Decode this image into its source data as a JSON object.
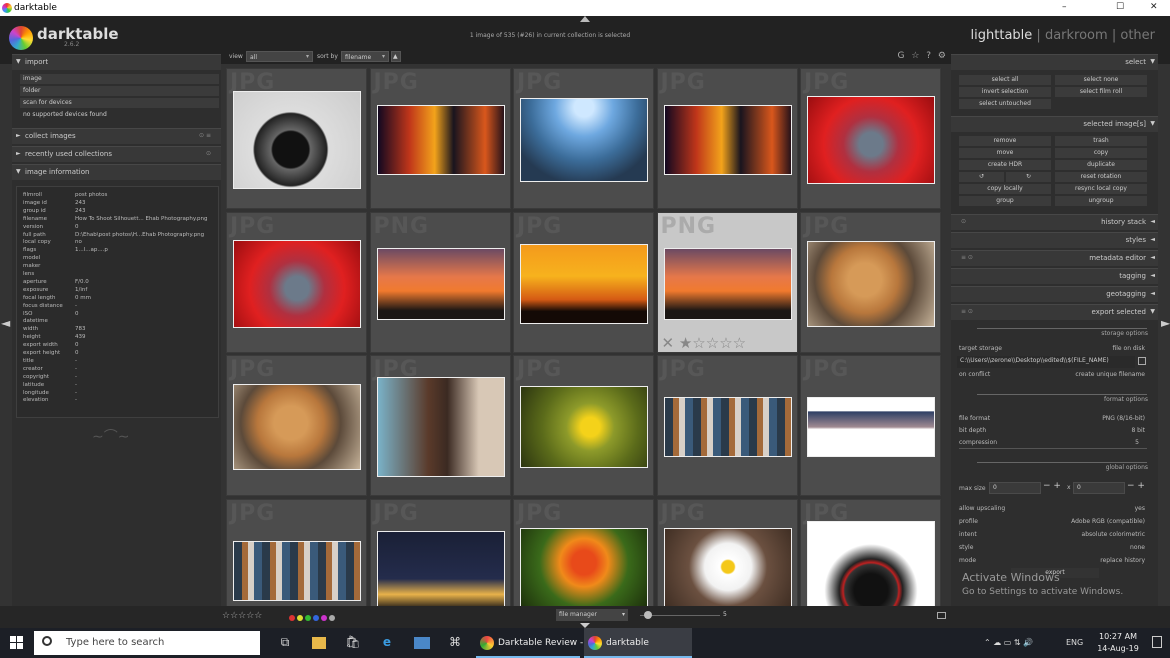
{
  "window": {
    "title": "darktable",
    "controls": [
      "–",
      "☐",
      "✕"
    ]
  },
  "header": {
    "app_name": "darktable",
    "version": "2.6.2",
    "hint": "1 image of 535 (#26) in current collection is selected",
    "views": {
      "lighttable": "lighttable",
      "sep1": "|",
      "darkroom": "darkroom",
      "sep2": "|",
      "other": "other"
    }
  },
  "toolbar": {
    "view_label": "view",
    "view_value": "all",
    "sort_label": "sort by",
    "sort_value": "filename",
    "sort_dir": "▲",
    "icons": [
      "G",
      "☆",
      "?",
      "⚙"
    ]
  },
  "left_panel": {
    "import": {
      "title": "import",
      "items": [
        "image",
        "folder",
        "scan for devices",
        "no supported devices found"
      ]
    },
    "collect_images": "collect images",
    "recently_used": "recently used collections",
    "image_information": {
      "title": "image information",
      "rows": [
        {
          "k": "filmroll",
          "v": "post photos"
        },
        {
          "k": "image id",
          "v": "243"
        },
        {
          "k": "group id",
          "v": "243"
        },
        {
          "k": "filename",
          "v": "How To Shoot Silhouett... Ehab Photography.png"
        },
        {
          "k": "version",
          "v": "0"
        },
        {
          "k": "full path",
          "v": "D:\\Ehab\\post photos\\H...Ehab Photography.png"
        },
        {
          "k": "local copy",
          "v": "no"
        },
        {
          "k": "flags",
          "v": "1...l...ap....p"
        },
        {
          "k": "model",
          "v": ""
        },
        {
          "k": "maker",
          "v": ""
        },
        {
          "k": "lens",
          "v": ""
        },
        {
          "k": "aperture",
          "v": "F/0.0"
        },
        {
          "k": "exposure",
          "v": "1/inf"
        },
        {
          "k": "focal length",
          "v": "0 mm"
        },
        {
          "k": "focus distance",
          "v": "-"
        },
        {
          "k": "ISO",
          "v": "0"
        },
        {
          "k": "datetime",
          "v": ""
        },
        {
          "k": "width",
          "v": "783"
        },
        {
          "k": "height",
          "v": "439"
        },
        {
          "k": "export width",
          "v": "0"
        },
        {
          "k": "export height",
          "v": "0"
        },
        {
          "k": "title",
          "v": "-"
        },
        {
          "k": "creator",
          "v": "-"
        },
        {
          "k": "copyright",
          "v": "-"
        },
        {
          "k": "latitude",
          "v": "-"
        },
        {
          "k": "longitude",
          "v": "-"
        },
        {
          "k": "elevation",
          "v": "-"
        }
      ]
    }
  },
  "grid": {
    "cells": [
      {
        "ext": "JPG",
        "img": "camera-mount"
      },
      {
        "ext": "JPG",
        "img": "city-night"
      },
      {
        "ext": "JPG",
        "img": "skyscrapers-fisheye"
      },
      {
        "ext": "JPG",
        "img": "city-night"
      },
      {
        "ext": "JPG",
        "img": "red-monitor"
      },
      {
        "ext": "JPG",
        "img": "red-monitor"
      },
      {
        "ext": "PNG",
        "img": "cyclist-sunset"
      },
      {
        "ext": "JPG",
        "img": "dancers-silhouette"
      },
      {
        "ext": "PNG",
        "img": "cyclist-sunset"
      },
      {
        "ext": "JPG",
        "img": "golden-retriever"
      },
      {
        "ext": "JPG",
        "img": "golden-retriever"
      },
      {
        "ext": "JPG",
        "img": "girl-portrait"
      },
      {
        "ext": "JPG",
        "img": "yellow-flower"
      },
      {
        "ext": "JPG",
        "img": "photo-mosaic"
      },
      {
        "ext": "JPG",
        "img": "pixabay-site"
      },
      {
        "ext": "JPG",
        "img": "photo-mosaic"
      },
      {
        "ext": "JPG",
        "img": "night-sky"
      },
      {
        "ext": "JPG",
        "img": "chili-plant"
      },
      {
        "ext": "JPG",
        "img": "white-daisy"
      },
      {
        "ext": "JPG",
        "img": "lens-cleaning"
      }
    ],
    "selected_index": 8,
    "selected_close": "✕",
    "selected_stars": "★☆☆☆☆"
  },
  "right_panel": {
    "select": {
      "title": "select",
      "buttons": [
        "select all",
        "select none",
        "invert selection",
        "select film roll",
        "select untouched"
      ]
    },
    "selected_images": {
      "title": "selected image[s]",
      "buttons": [
        "remove",
        "trash",
        "move",
        "copy",
        "create HDR",
        "duplicate",
        "↺",
        "↻",
        "reset rotation",
        "copy locally",
        "resync local copy",
        "group",
        "ungroup"
      ]
    },
    "history_stack": "history stack",
    "styles": "styles",
    "metadata_editor": "metadata editor",
    "tagging": "tagging",
    "geotagging": "geotagging",
    "export": {
      "title": "export selected",
      "storage_options": "storage options",
      "target_storage_label": "target storage",
      "target_storage_value": "file on disk",
      "path": "C:\\\\Users\\\\zerone\\\\Desktop\\\\edited\\\\$(FILE_NAME)",
      "on_conflict_label": "on conflict",
      "on_conflict_value": "create unique filename",
      "format_options": "format options",
      "file_format_label": "file format",
      "file_format_value": "PNG (8/16-bit)",
      "bit_depth_label": "bit depth",
      "bit_depth_value": "8 bit",
      "compression_label": "compression",
      "compression_value": "5",
      "global_options": "global options",
      "max_size_label": "max size",
      "max_w": "0",
      "max_x": "x",
      "max_h": "0",
      "allow_upscaling_label": "allow upscaling",
      "allow_upscaling_value": "yes",
      "profile_label": "profile",
      "profile_value": "Adobe RGB (compatible)",
      "intent_label": "intent",
      "intent_value": "absolute colorimetric",
      "style_label": "style",
      "style_value": "none",
      "mode_label": "mode",
      "mode_value": "replace history",
      "export_button": "export"
    }
  },
  "watermark": {
    "line1": "Activate Windows",
    "line2": "Go to Settings to activate Windows."
  },
  "bottom": {
    "stars": "☆☆☆☆☆",
    "color_labels": [
      "#d33",
      "#dd3",
      "#3b3",
      "#36d",
      "#c3c",
      "#aaa"
    ],
    "layout": "file manager",
    "zoom": "5"
  },
  "taskbar": {
    "search_placeholder": "Type here to search",
    "apps": [
      {
        "label": "Darktable Review - ...",
        "color": "#e44"
      },
      {
        "label": "darktable",
        "color": "#c5c"
      }
    ],
    "lang": "ENG",
    "time": "10:27 AM",
    "date": "14-Aug-19"
  }
}
